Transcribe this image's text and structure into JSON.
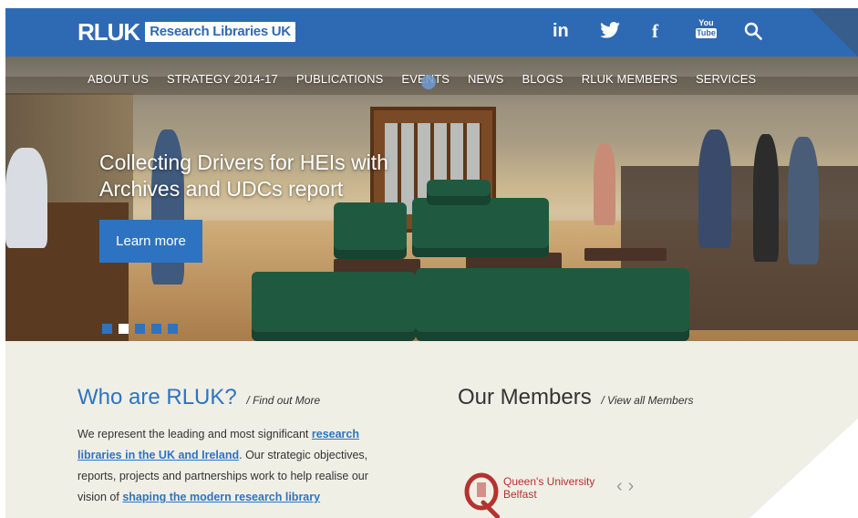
{
  "header": {
    "logo_word": "RLUK",
    "logo_box": "Research Libraries UK",
    "social": {
      "linkedin": "in",
      "facebook": "f",
      "youtube_top": "You",
      "youtube_bottom": "Tube"
    }
  },
  "nav": [
    "ABOUT US",
    "STRATEGY 2014-17",
    "PUBLICATIONS",
    "EVENTS",
    "NEWS",
    "BLOGS",
    "RLUK MEMBERS",
    "SERVICES"
  ],
  "hero": {
    "title": "Collecting Drivers for HEIs with Archives and UDCs report",
    "button": "Learn more",
    "slide_count": 5,
    "active_slide": 2
  },
  "who": {
    "title": "Who are RLUK?",
    "sub": "/ Find out More",
    "text_1": "We represent the leading and most significant ",
    "link_1": "research libraries in the UK and Ireland",
    "text_2": ". Our strategic objectives, reports, projects and partnerships work to help realise our vision of ",
    "link_2": "shaping the modern research library"
  },
  "members": {
    "title": "Our Members",
    "sub": "/ View all Members",
    "logo_line1": "Queen's University",
    "logo_line2": "Belfast",
    "prev": "‹",
    "next": "›"
  },
  "colors": {
    "brand": "#2e6ab3",
    "accent": "#2e73c2",
    "qub_red": "#b5322f"
  }
}
